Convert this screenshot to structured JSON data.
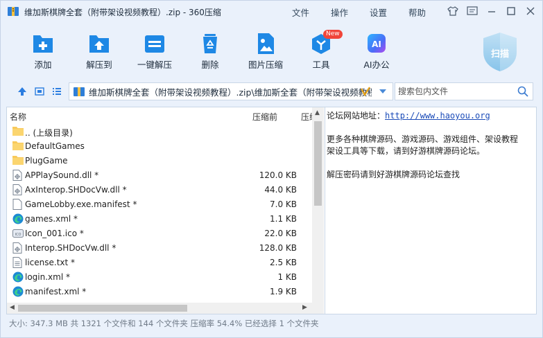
{
  "title": "维加斯棋牌全套（附带架设视频教程）.zip - 360压缩",
  "menu": [
    "文件",
    "操作",
    "设置",
    "帮助"
  ],
  "toolbar": {
    "buttons": [
      "添加",
      "解压到",
      "一键解压",
      "删除",
      "图片压缩",
      "工具",
      "AI办公"
    ],
    "new_badge": "New",
    "ai_icon_text": "AI",
    "scan": "扫描"
  },
  "address": {
    "path": "维加斯棋牌全套（附带架设视频教程）.zip\\维加斯全套（附带架设视频教程）",
    "search_placeholder": "搜索包内文件"
  },
  "columns": {
    "name": "名称",
    "size_before": "压缩前",
    "size_after": "压缩后"
  },
  "files": [
    {
      "name": ".. (上级目录)",
      "size": "",
      "icon": "folder-icon"
    },
    {
      "name": "DefaultGames",
      "size": "",
      "icon": "folder-icon"
    },
    {
      "name": "PlugGame",
      "size": "",
      "icon": "folder-icon"
    },
    {
      "name": "APPlaySound.dll *",
      "size": "120.0 KB",
      "icon": "dll-file-icon"
    },
    {
      "name": "AxInterop.SHDocVw.dll *",
      "size": "44.0 KB",
      "icon": "dll-file-icon"
    },
    {
      "name": "GameLobby.exe.manifest *",
      "size": "7.0 KB",
      "icon": "document-icon"
    },
    {
      "name": "games.xml *",
      "size": "1.1 KB",
      "icon": "edge-xml-icon"
    },
    {
      "name": "Icon_001.ico *",
      "size": "22.0 KB",
      "icon": "ico-file-icon"
    },
    {
      "name": "Interop.SHDocVw.dll *",
      "size": "128.0 KB",
      "icon": "dll-file-icon"
    },
    {
      "name": "license.txt *",
      "size": "2.5 KB",
      "icon": "text-file-icon"
    },
    {
      "name": "login.xml *",
      "size": "1 KB",
      "icon": "edge-xml-icon"
    },
    {
      "name": "manifest.xml *",
      "size": "1.9 KB",
      "icon": "edge-xml-icon"
    }
  ],
  "comment": {
    "line1_label": "论坛网站地址：",
    "line1_link": "http://www.haoyou.org",
    "line2": "更多各种棋牌源码、游戏源码、游戏组件、架设教程",
    "line3": "架设工具等下载，请到好游棋牌源码论坛。",
    "line4": "解压密码请到好游棋牌源码论坛查找"
  },
  "status": "大小: 347.3 MB 共 1321 个文件和 144 个文件夹 压缩率 54.4% 已经选择 1 个文件夹",
  "colors": {
    "accent": "#1e88e5",
    "background": "#eaf1fb",
    "link": "#1a4bb8",
    "new_badge": "#f0453a"
  }
}
